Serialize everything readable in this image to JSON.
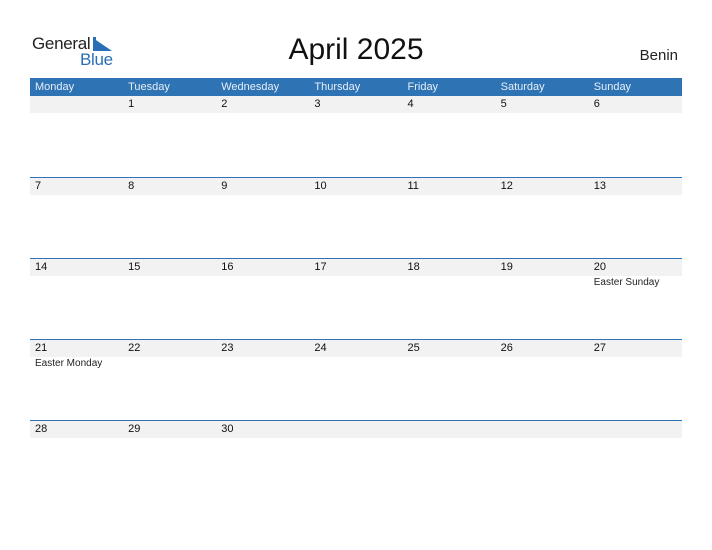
{
  "logo": {
    "word1": "General",
    "word2": "Blue"
  },
  "title": "April 2025",
  "country": "Benin",
  "colors": {
    "header_bg": "#2e74b5",
    "strip_bg": "#f2f2f2",
    "brand_blue": "#2a6fb5"
  },
  "weekdays": [
    "Monday",
    "Tuesday",
    "Wednesday",
    "Thursday",
    "Friday",
    "Saturday",
    "Sunday"
  ],
  "weeks": [
    {
      "days": [
        {
          "num": "",
          "event": ""
        },
        {
          "num": "1",
          "event": ""
        },
        {
          "num": "2",
          "event": ""
        },
        {
          "num": "3",
          "event": ""
        },
        {
          "num": "4",
          "event": ""
        },
        {
          "num": "5",
          "event": ""
        },
        {
          "num": "6",
          "event": ""
        }
      ]
    },
    {
      "days": [
        {
          "num": "7",
          "event": ""
        },
        {
          "num": "8",
          "event": ""
        },
        {
          "num": "9",
          "event": ""
        },
        {
          "num": "10",
          "event": ""
        },
        {
          "num": "11",
          "event": ""
        },
        {
          "num": "12",
          "event": ""
        },
        {
          "num": "13",
          "event": ""
        }
      ]
    },
    {
      "days": [
        {
          "num": "14",
          "event": ""
        },
        {
          "num": "15",
          "event": ""
        },
        {
          "num": "16",
          "event": ""
        },
        {
          "num": "17",
          "event": ""
        },
        {
          "num": "18",
          "event": ""
        },
        {
          "num": "19",
          "event": ""
        },
        {
          "num": "20",
          "event": "Easter Sunday"
        }
      ]
    },
    {
      "days": [
        {
          "num": "21",
          "event": "Easter Monday"
        },
        {
          "num": "22",
          "event": ""
        },
        {
          "num": "23",
          "event": ""
        },
        {
          "num": "24",
          "event": ""
        },
        {
          "num": "25",
          "event": ""
        },
        {
          "num": "26",
          "event": ""
        },
        {
          "num": "27",
          "event": ""
        }
      ]
    },
    {
      "days": [
        {
          "num": "28",
          "event": ""
        },
        {
          "num": "29",
          "event": ""
        },
        {
          "num": "30",
          "event": ""
        },
        {
          "num": "",
          "event": ""
        },
        {
          "num": "",
          "event": ""
        },
        {
          "num": "",
          "event": ""
        },
        {
          "num": "",
          "event": ""
        }
      ]
    }
  ]
}
